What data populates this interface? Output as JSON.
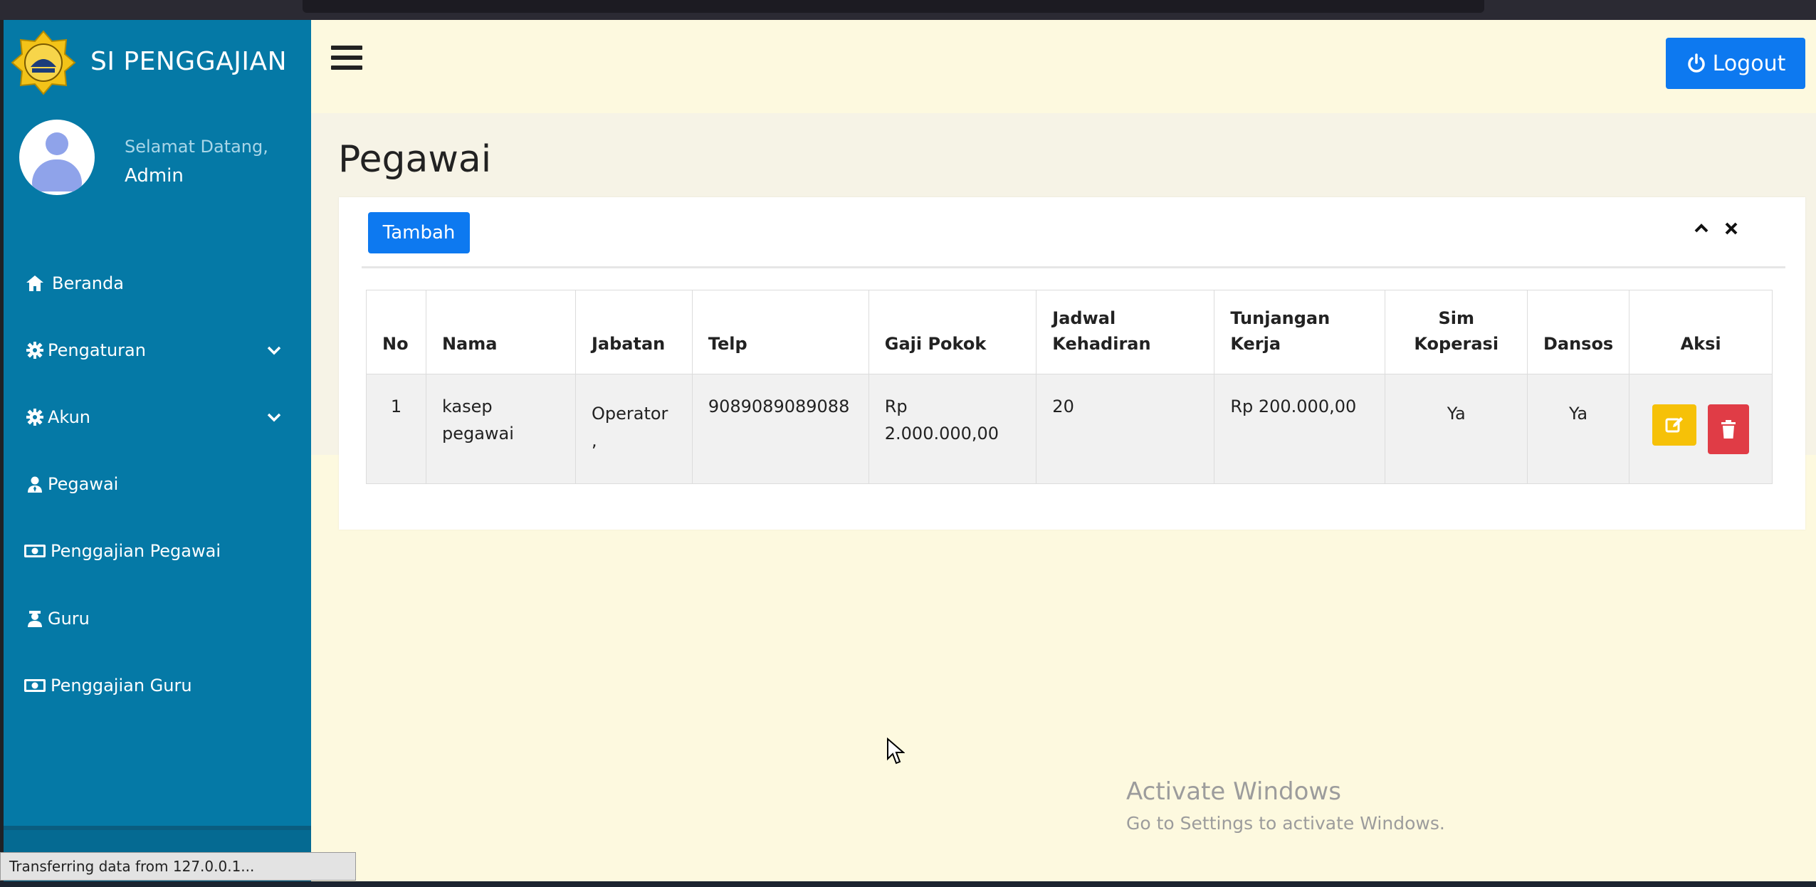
{
  "brand": {
    "title": "SI PENGGAJIAN"
  },
  "user": {
    "welcome": "Selamat Datang,",
    "name": "Admin"
  },
  "sidebar": {
    "items": [
      {
        "label": "Beranda",
        "icon": "home-icon"
      },
      {
        "label": "Pengaturan",
        "icon": "gear-icon",
        "expandable": true
      },
      {
        "label": "Akun",
        "icon": "gear-icon",
        "expandable": true
      },
      {
        "label": "Pegawai",
        "icon": "user-tie-icon"
      },
      {
        "label": "Penggajian Pegawai",
        "icon": "money-bill-icon"
      },
      {
        "label": "Guru",
        "icon": "teacher-icon"
      },
      {
        "label": "Penggajian Guru",
        "icon": "money-bill-icon"
      }
    ]
  },
  "topbar": {
    "logout_label": "Logout"
  },
  "page": {
    "title": "Pegawai"
  },
  "card": {
    "add_label": "Tambah"
  },
  "table": {
    "headers": {
      "no": "No",
      "nama": "Nama",
      "jabatan": "Jabatan",
      "telp": "Telp",
      "gaji_pokok": "Gaji Pokok",
      "jadwal_1": "Jadwal",
      "jadwal_2": "Kehadiran",
      "tunjangan_1": "Tunjangan",
      "tunjangan_2": "Kerja",
      "sim_1": "Sim",
      "sim_2": "Koperasi",
      "dansos": "Dansos",
      "aksi": "Aksi"
    },
    "rows": [
      {
        "no": "1",
        "nama_1": "kasep",
        "nama_2": "pegawai",
        "jabatan_1": "Operator",
        "jabatan_2": ",",
        "telp": "9089089089088",
        "gaji_1": "Rp",
        "gaji_2": "2.000.000,00",
        "jadwal": "20",
        "tunjangan": "Rp 200.000,00",
        "sim_koperasi": "Ya",
        "dansos": "Ya"
      }
    ]
  },
  "watermark": {
    "line1": "Activate Windows",
    "line2": "Go to Settings to activate Windows."
  },
  "status_bar": {
    "text": "Transferring data from 127.0.0.1..."
  }
}
